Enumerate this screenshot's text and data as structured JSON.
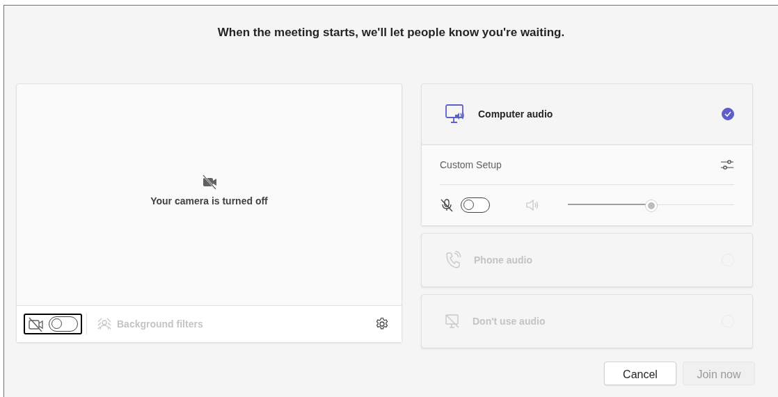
{
  "heading": "When the meeting starts, we'll let people know you're waiting.",
  "camera": {
    "message": "Your camera is turned off",
    "on": false,
    "background_filters": {
      "label": "Background filters",
      "disabled": true
    }
  },
  "audio_options": [
    {
      "kind": "computer",
      "label": "Computer audio",
      "selected": true,
      "disabled": false
    },
    {
      "kind": "phone",
      "label": "Phone audio",
      "selected": false,
      "disabled": true
    },
    {
      "kind": "none",
      "label": "Don't use audio",
      "selected": false,
      "disabled": true
    }
  ],
  "custom_setup": {
    "label": "Custom Setup",
    "mic_on": false,
    "volume": {
      "level": 0.5
    }
  },
  "buttons": [
    {
      "label": "Cancel",
      "disabled": false
    },
    {
      "label": "Join now",
      "disabled": true
    }
  ]
}
